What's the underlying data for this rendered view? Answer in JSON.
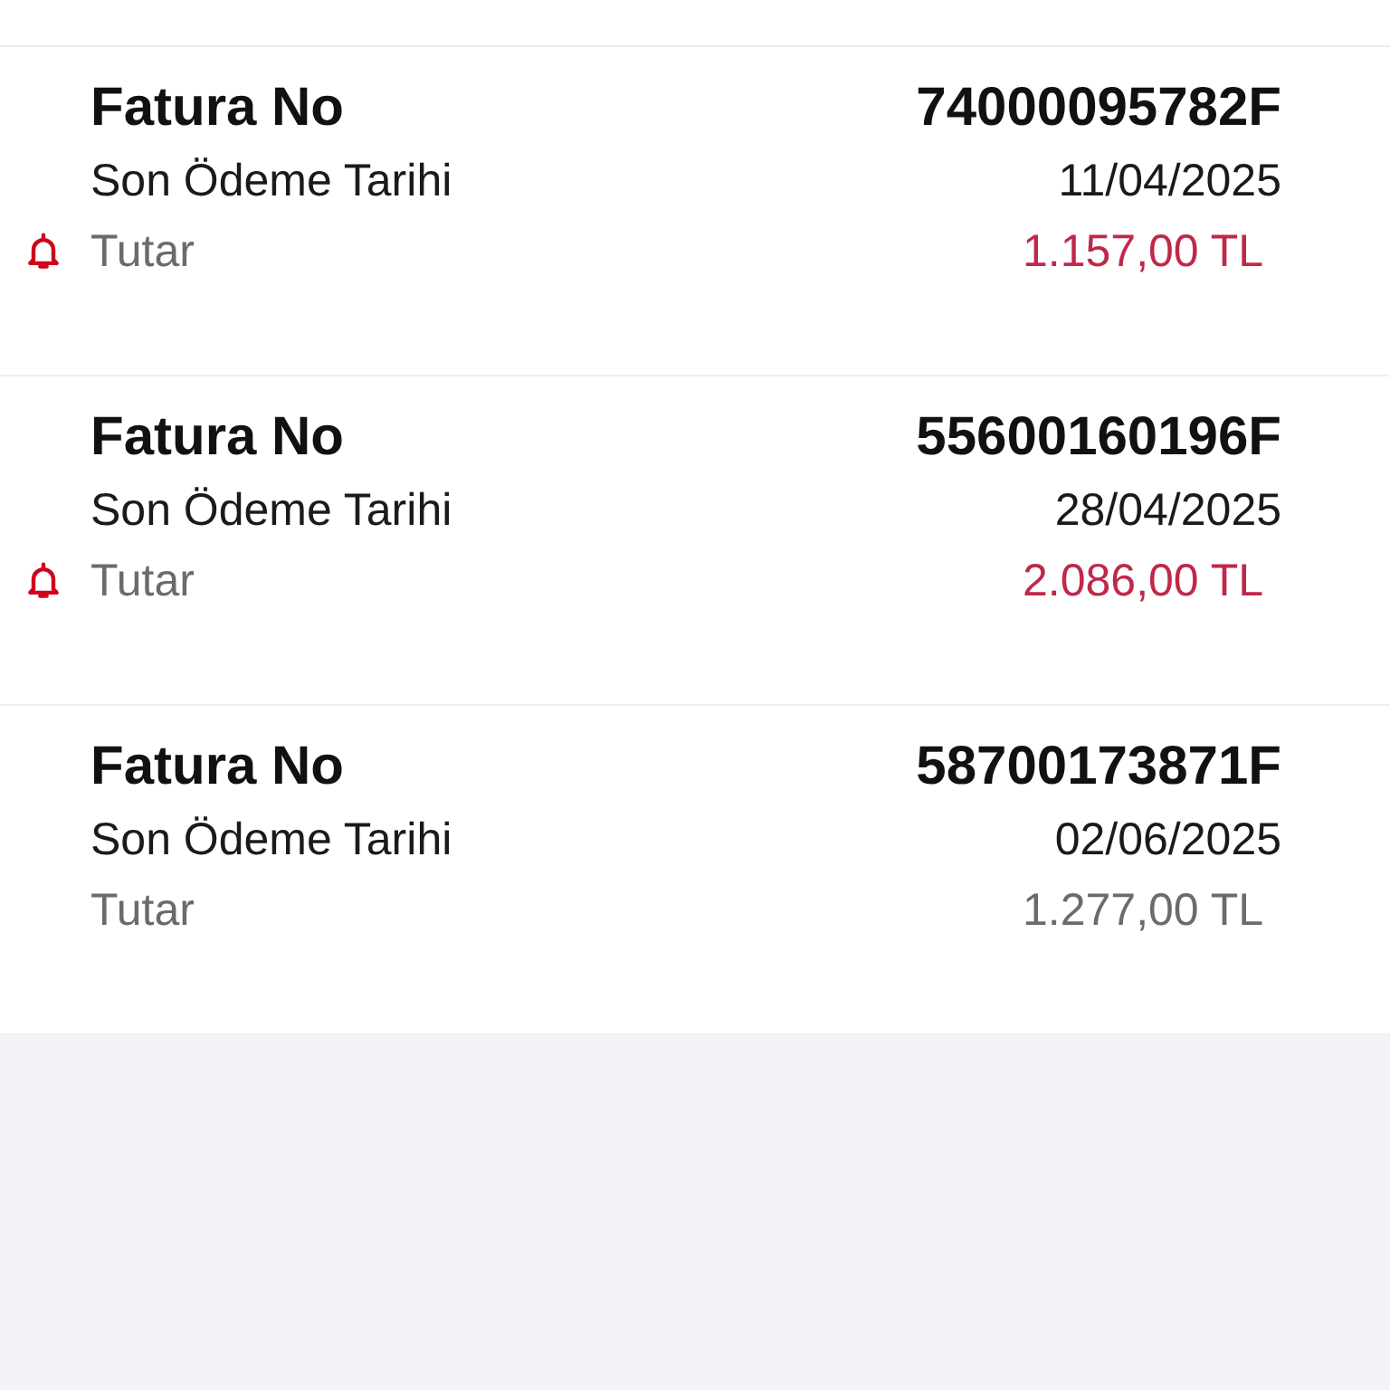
{
  "invoices": [
    {
      "invoice_no_label": "Fatura No",
      "invoice_no": "74000095782F",
      "due_date_label": "Son Ödeme Tarihi",
      "due_date": "11/04/2025",
      "amount_label": "Tutar",
      "amount": "1.157,00 TL",
      "alert": true
    },
    {
      "invoice_no_label": "Fatura No",
      "invoice_no": "55600160196F",
      "due_date_label": "Son Ödeme Tarihi",
      "due_date": "28/04/2025",
      "amount_label": "Tutar",
      "amount": "2.086,00 TL",
      "alert": true
    },
    {
      "invoice_no_label": "Fatura No",
      "invoice_no": "58700173871F",
      "due_date_label": "Son Ödeme Tarihi",
      "due_date": "02/06/2025",
      "amount_label": "Tutar",
      "amount": "1.277,00 TL",
      "alert": false
    }
  ]
}
